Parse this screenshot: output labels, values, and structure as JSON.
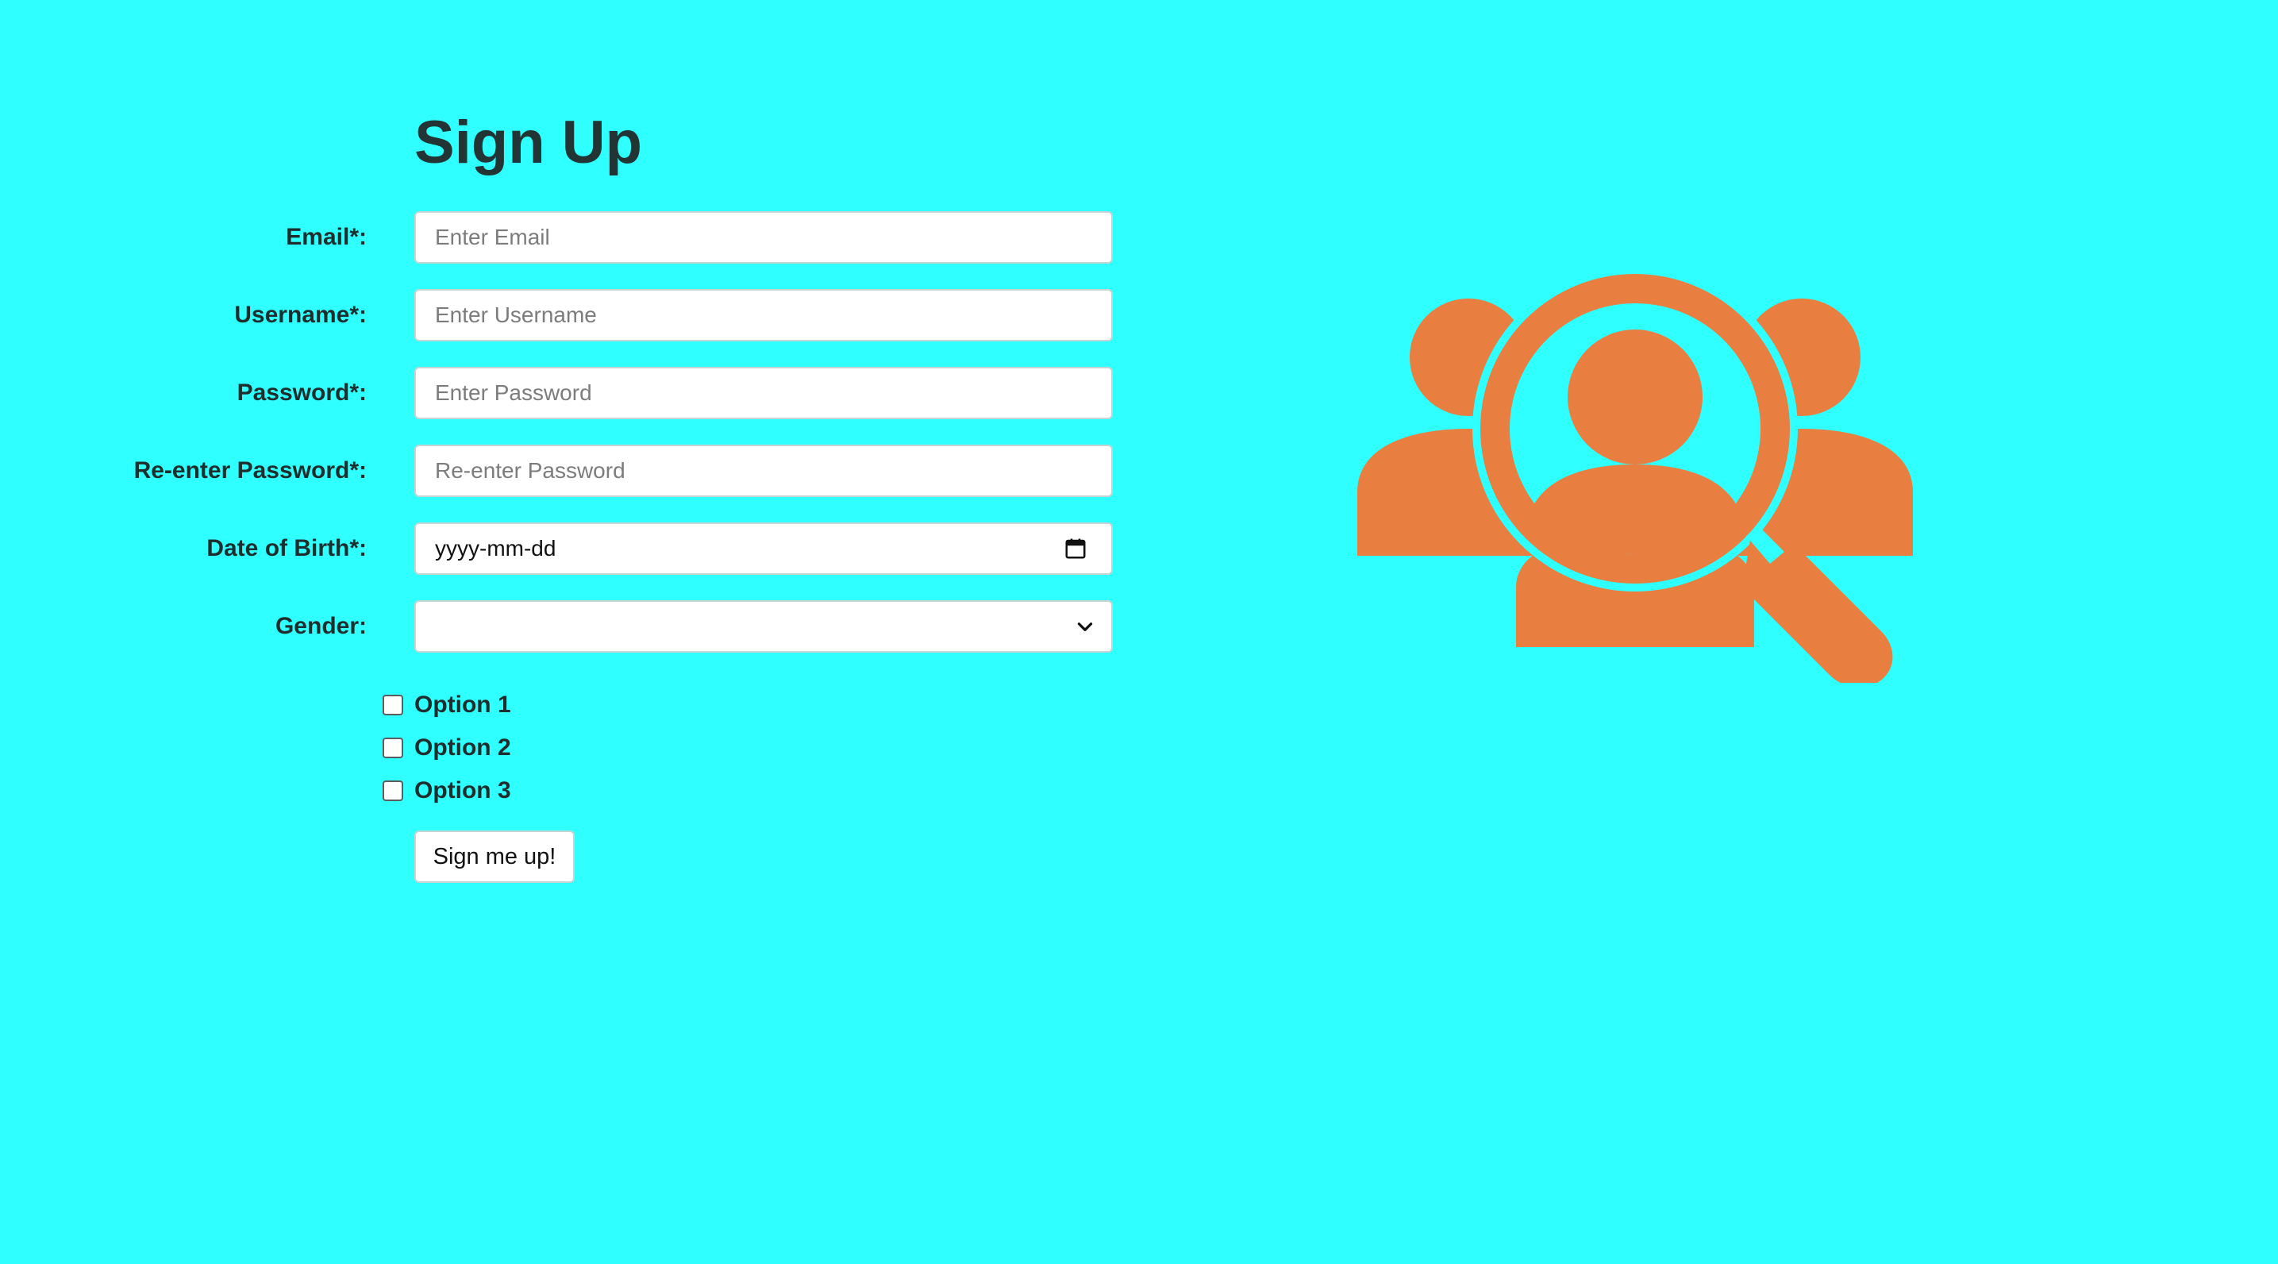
{
  "page": {
    "title": "Sign Up",
    "background_color": "#2ffffe",
    "accent_color": "#e87e40"
  },
  "form": {
    "fields": [
      {
        "label": "Email*:",
        "placeholder": "Enter Email",
        "type": "text"
      },
      {
        "label": "Username*:",
        "placeholder": "Enter Username",
        "type": "text"
      },
      {
        "label": "Password*:",
        "placeholder": "Enter Password",
        "type": "password"
      },
      {
        "label": "Re-enter Password*:",
        "placeholder": "Re-enter Password",
        "type": "password"
      }
    ],
    "dob": {
      "label": "Date of Birth*:",
      "value": "yyyy-mm-dd",
      "icon": "calendar-icon"
    },
    "gender": {
      "label": "Gender:",
      "value": "",
      "icon": "chevron-down-icon"
    },
    "options": [
      {
        "label": "Option 1",
        "checked": false
      },
      {
        "label": "Option 2",
        "checked": false
      },
      {
        "label": "Option 3",
        "checked": false
      }
    ],
    "submit_label": "Sign me up!"
  },
  "illustration": {
    "icon": "user-search-icon",
    "color": "#e87e40"
  }
}
